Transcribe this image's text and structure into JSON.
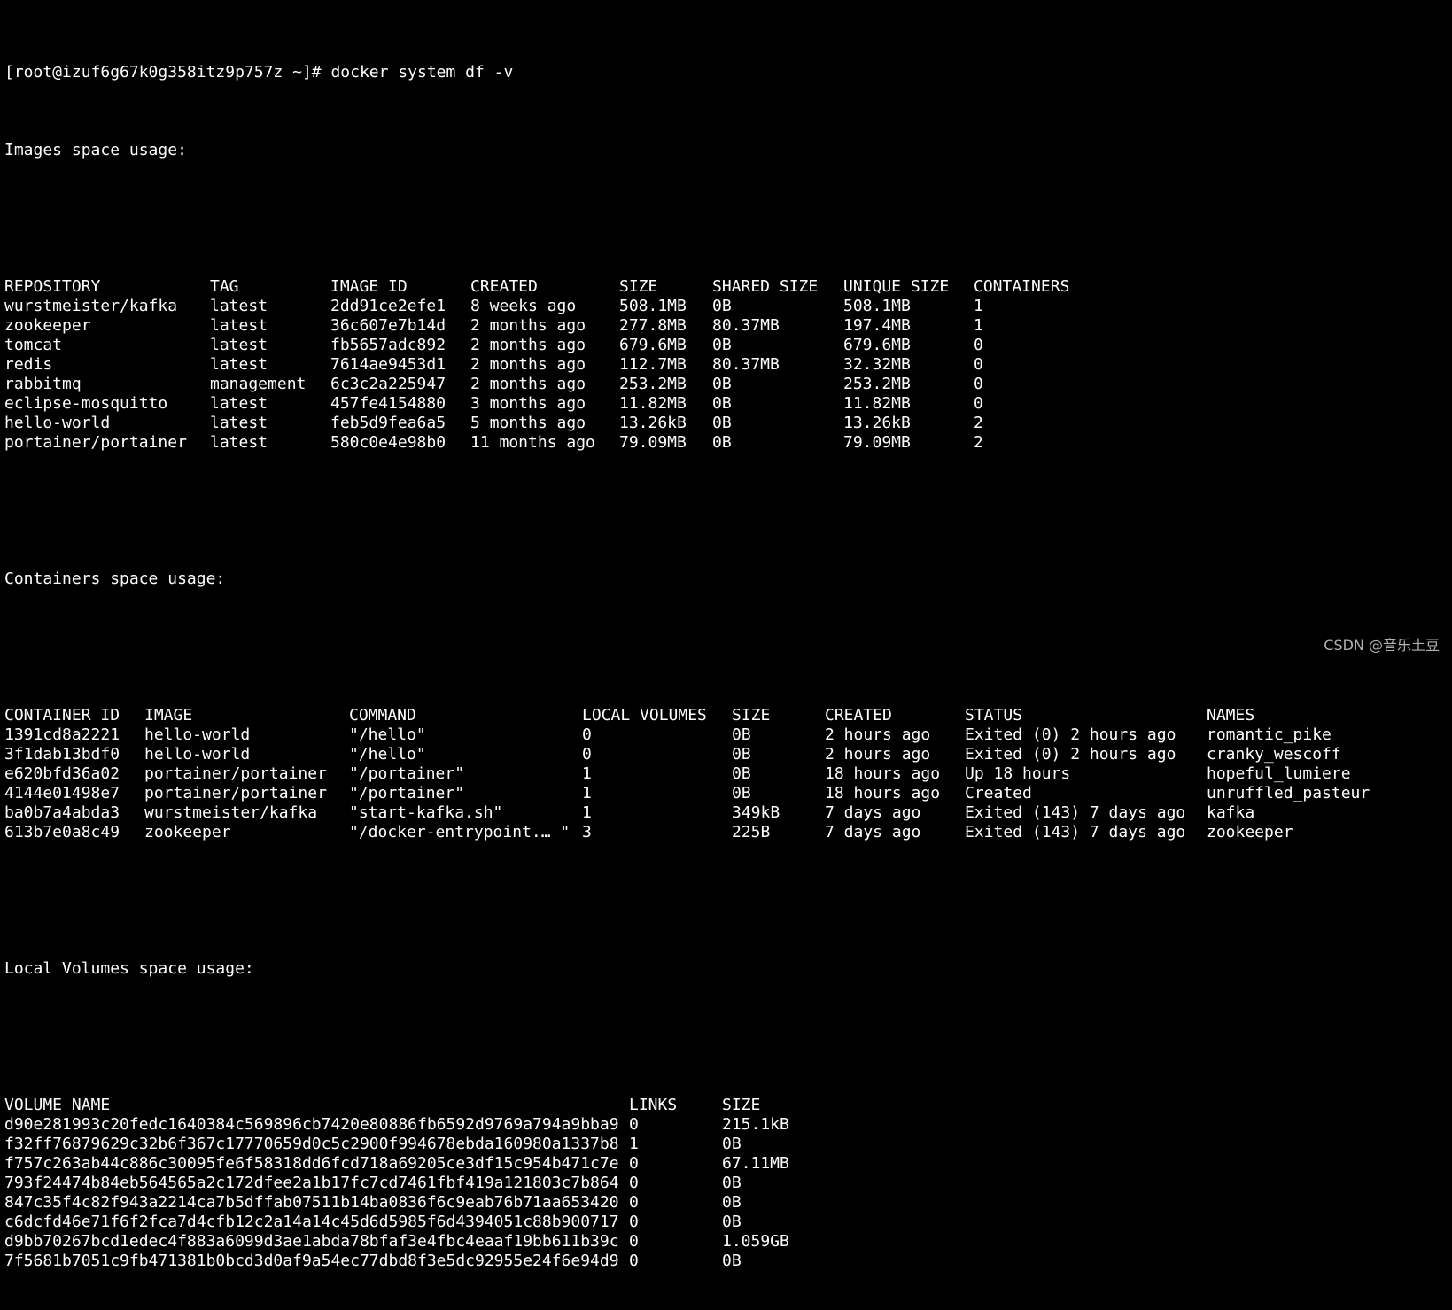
{
  "prompt": {
    "text": "[root@izuf6g67k0g358itz9p757z ~]# docker system df -v"
  },
  "images": {
    "title": "Images space usage:",
    "headers": [
      "REPOSITORY",
      "TAG",
      "IMAGE ID",
      "CREATED",
      "SIZE",
      "SHARED SIZE",
      "UNIQUE SIZE",
      "CONTAINERS"
    ],
    "rows": [
      [
        "wurstmeister/kafka",
        "latest",
        "2dd91ce2efe1",
        "8 weeks ago",
        "508.1MB",
        "0B",
        "508.1MB",
        "1"
      ],
      [
        "zookeeper",
        "latest",
        "36c607e7b14d",
        "2 months ago",
        "277.8MB",
        "80.37MB",
        "197.4MB",
        "1"
      ],
      [
        "tomcat",
        "latest",
        "fb5657adc892",
        "2 months ago",
        "679.6MB",
        "0B",
        "679.6MB",
        "0"
      ],
      [
        "redis",
        "latest",
        "7614ae9453d1",
        "2 months ago",
        "112.7MB",
        "80.37MB",
        "32.32MB",
        "0"
      ],
      [
        "rabbitmq",
        "management",
        "6c3c2a225947",
        "2 months ago",
        "253.2MB",
        "0B",
        "253.2MB",
        "0"
      ],
      [
        "eclipse-mosquitto",
        "latest",
        "457fe4154880",
        "3 months ago",
        "11.82MB",
        "0B",
        "11.82MB",
        "0"
      ],
      [
        "hello-world",
        "latest",
        "feb5d9fea6a5",
        "5 months ago",
        "13.26kB",
        "0B",
        "13.26kB",
        "2"
      ],
      [
        "portainer/portainer",
        "latest",
        "580c0e4e98b0",
        "11 months ago",
        "79.09MB",
        "0B",
        "79.09MB",
        "2"
      ]
    ]
  },
  "containers": {
    "title": "Containers space usage:",
    "headers": [
      "CONTAINER ID",
      "IMAGE",
      "COMMAND",
      "LOCAL VOLUMES",
      "SIZE",
      "CREATED",
      "STATUS",
      "NAMES"
    ],
    "rows": [
      [
        "1391cd8a2221",
        "hello-world",
        "\"/hello\"",
        "0",
        "0B",
        "2 hours ago",
        "Exited (0) 2 hours ago",
        "romantic_pike"
      ],
      [
        "3f1dab13bdf0",
        "hello-world",
        "\"/hello\"",
        "0",
        "0B",
        "2 hours ago",
        "Exited (0) 2 hours ago",
        "cranky_wescoff"
      ],
      [
        "e620bfd36a02",
        "portainer/portainer",
        "\"/portainer\"",
        "1",
        "0B",
        "18 hours ago",
        "Up 18 hours",
        "hopeful_lumiere"
      ],
      [
        "4144e01498e7",
        "portainer/portainer",
        "\"/portainer\"",
        "1",
        "0B",
        "18 hours ago",
        "Created",
        "unruffled_pasteur"
      ],
      [
        "ba0b7a4abda3",
        "wurstmeister/kafka",
        "\"start-kafka.sh\"",
        "1",
        "349kB",
        "7 days ago",
        "Exited (143) 7 days ago",
        "kafka"
      ],
      [
        "613b7e0a8c49",
        "zookeeper",
        "\"/docker-entrypoint.… \"",
        "3",
        "225B",
        "7 days ago",
        "Exited (143) 7 days ago",
        "zookeeper"
      ]
    ]
  },
  "volumes": {
    "title": "Local Volumes space usage:",
    "headers": [
      "VOLUME NAME",
      "LINKS",
      "SIZE"
    ],
    "rows": [
      [
        "d90e281993c20fedc1640384c569896cb7420e80886fb6592d9769a794a9bba9",
        "0",
        "215.1kB"
      ],
      [
        "f32ff76879629c32b6f367c17770659d0c5c2900f994678ebda160980a1337b8",
        "1",
        "0B"
      ],
      [
        "f757c263ab44c886c30095fe6f58318dd6fcd718a69205ce3df15c954b471c7e",
        "0",
        "67.11MB"
      ],
      [
        "793f24474b84eb564565a2c172dfee2a1b17fc7cd7461fbf419a121803c7b864",
        "0",
        "0B"
      ],
      [
        "847c35f4c82f943a2214ca7b5dffab07511b14ba0836f6c9eab76b71aa653420",
        "0",
        "0B"
      ],
      [
        "c6dcfd46e71f6f2fca7d4cfb12c2a14a14c45d6d5985f6d4394051c88b900717",
        "0",
        "0B"
      ],
      [
        "d9bb70267bcd1edec4f883a6099d3ae1abda78bfaf3e4fbc4eaaf19bb611b39c",
        "0",
        "1.059GB"
      ],
      [
        "7f5681b7051c9fb471381b0bcd3d0af9a54ec77dbd8f3e5dc92955e24f6e94d9",
        "0",
        "0B"
      ]
    ]
  },
  "watermark": {
    "text": "CSDN @音乐土豆"
  },
  "colors": {
    "background": "#000000",
    "foreground": "#ffffff"
  }
}
